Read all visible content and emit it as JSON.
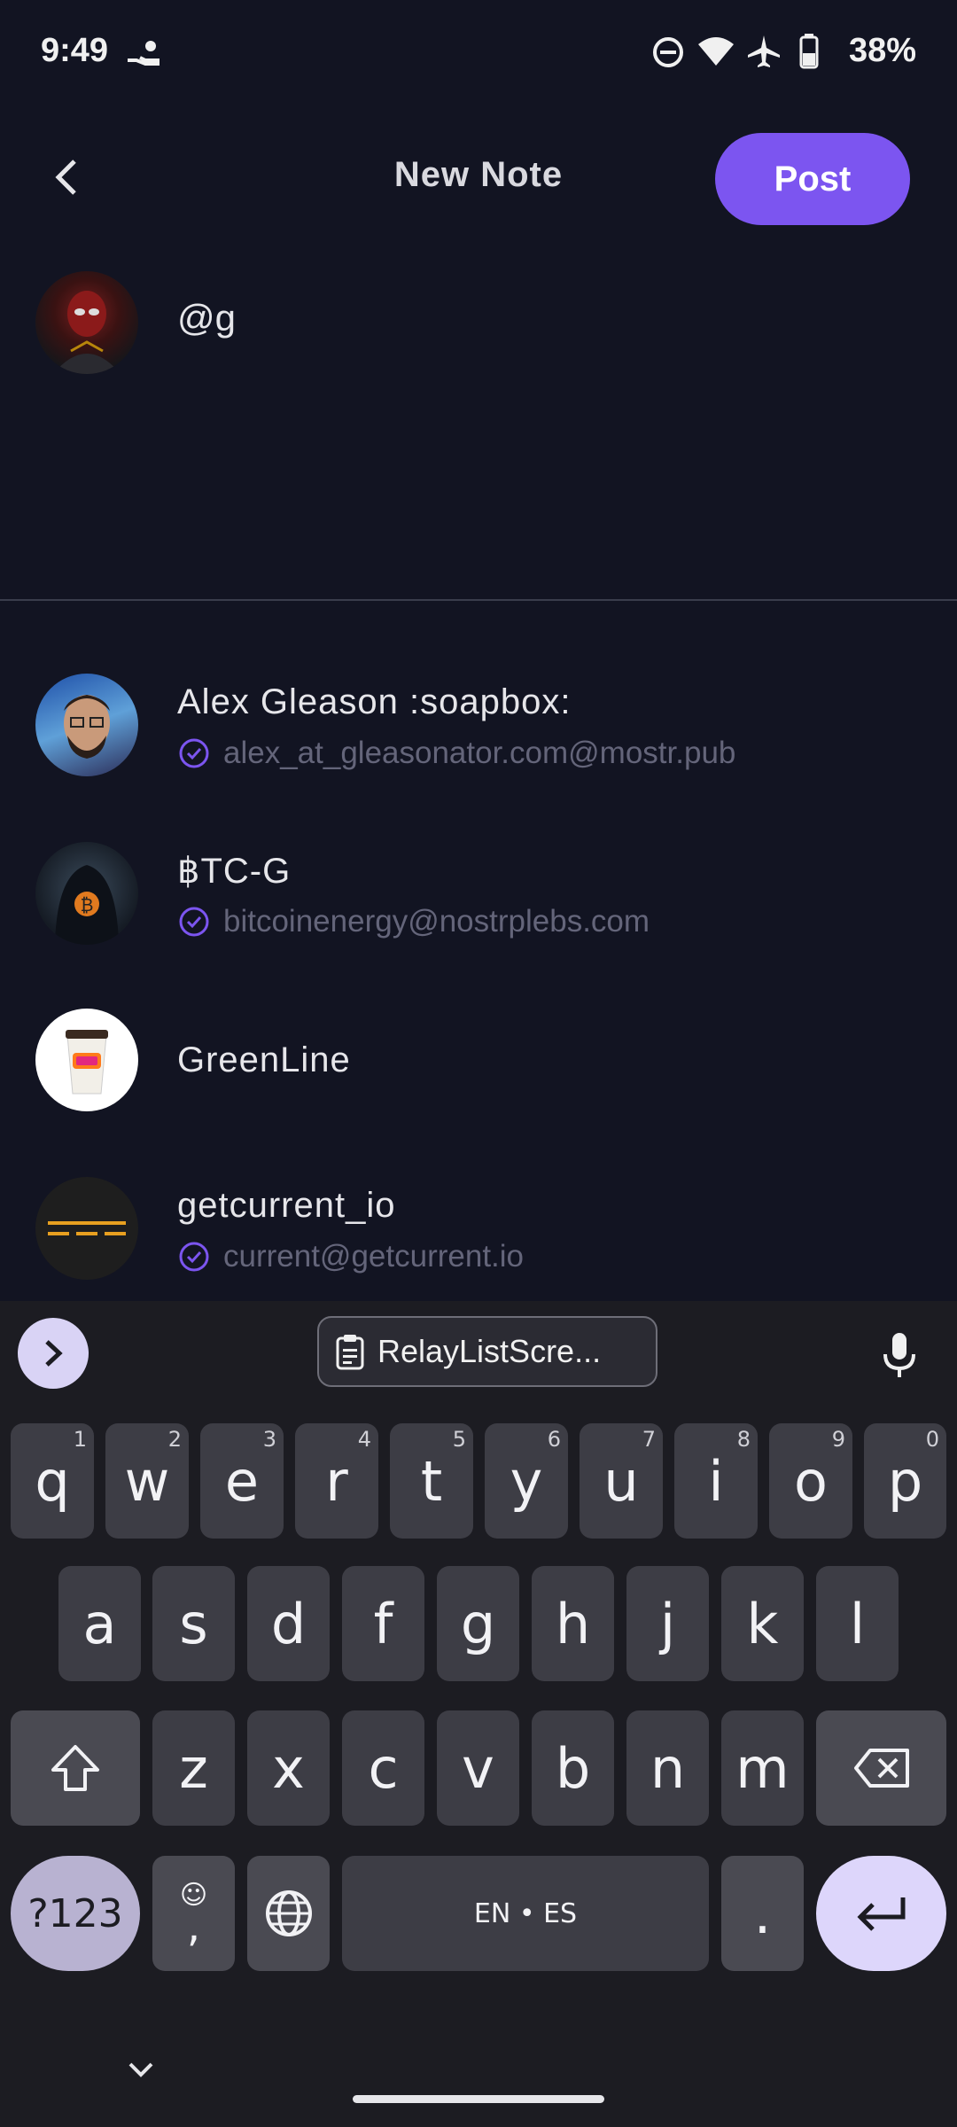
{
  "status_bar": {
    "time": "9:49",
    "battery": "38%"
  },
  "header": {
    "title": "New Note",
    "post_label": "Post"
  },
  "composer": {
    "text": "@g"
  },
  "suggestions": [
    {
      "name": "Alex Gleason :soapbox:",
      "nip05": "alex_at_gleasonator.com@mostr.pub"
    },
    {
      "name": "฿TC-G",
      "nip05": "bitcoinenergy@nostrplebs.com"
    },
    {
      "name": "GreenLine",
      "nip05": ""
    },
    {
      "name": "getcurrent_io",
      "nip05": "current@getcurrent.io"
    }
  ],
  "keyboard": {
    "clipboard_label": "RelayListScre...",
    "row1": [
      {
        "k": "q",
        "h": "1"
      },
      {
        "k": "w",
        "h": "2"
      },
      {
        "k": "e",
        "h": "3"
      },
      {
        "k": "r",
        "h": "4"
      },
      {
        "k": "t",
        "h": "5"
      },
      {
        "k": "y",
        "h": "6"
      },
      {
        "k": "u",
        "h": "7"
      },
      {
        "k": "i",
        "h": "8"
      },
      {
        "k": "o",
        "h": "9"
      },
      {
        "k": "p",
        "h": "0"
      }
    ],
    "row2": [
      "a",
      "s",
      "d",
      "f",
      "g",
      "h",
      "j",
      "k",
      "l"
    ],
    "row3": [
      "z",
      "x",
      "c",
      "v",
      "b",
      "n",
      "m"
    ],
    "symbols_label": "?123",
    "comma_label": ",",
    "space_label": "EN • ES",
    "period_label": "."
  },
  "accent_color": "#7c55f0"
}
